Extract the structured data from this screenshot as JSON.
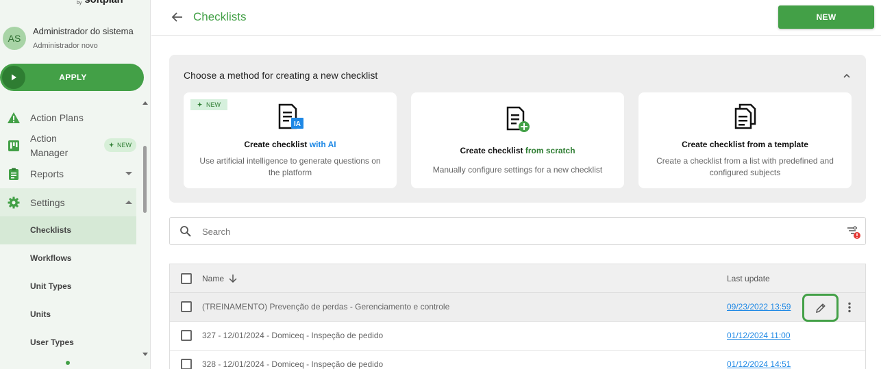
{
  "brand": {
    "by": "by",
    "name": "softplan"
  },
  "user": {
    "initials": "AS",
    "name": "Administrador do sistema",
    "role": "Administrador novo"
  },
  "apply_label": "APPLY",
  "sidebar": {
    "items": [
      {
        "label": "Action Plans",
        "icon": "warning-icon"
      },
      {
        "label": "Action\nManager",
        "icon": "kanban-icon",
        "badge": "NEW"
      },
      {
        "label": "Reports",
        "icon": "clipboard-icon"
      },
      {
        "label": "Settings",
        "icon": "gear-icon"
      }
    ],
    "settings_sub": [
      "Checklists",
      "Workflows",
      "Unit Types",
      "Units",
      "User Types"
    ],
    "active_sub": "Checklists"
  },
  "header": {
    "title": "Checklists",
    "new_button": "NEW"
  },
  "methods": {
    "title": "Choose a method for creating a new checklist",
    "cards": [
      {
        "badge": "NEW",
        "title_prefix": "Create checklist ",
        "title_highlight": "with AI",
        "description": "Use artificial intelligence to generate questions on the platform"
      },
      {
        "title_prefix": "Create checklist ",
        "title_highlight": "from scratch",
        "description": "Manually configure settings for a new checklist"
      },
      {
        "title_prefix": "Create checklist from a template",
        "title_highlight": "",
        "description": "Create a checklist from a list with predefined and configured subjects"
      }
    ]
  },
  "search": {
    "placeholder": "Search",
    "value": ""
  },
  "table": {
    "columns": {
      "name": "Name",
      "last_update": "Last update"
    },
    "rows": [
      {
        "name": "(TREINAMENTO) Prevenção de perdas - Gerenciamento e controle",
        "last_update": "09/23/2022 13:59"
      },
      {
        "name": "327 - 12/01/2024 - Domiceq - Inspeção de pedido",
        "last_update": "01/12/2024 11:00"
      },
      {
        "name": "328 - 12/01/2024 - Domiceq - Inspeção de pedido",
        "last_update": "01/12/2024 14:51"
      }
    ]
  },
  "colors": {
    "primary": "#43a047",
    "link": "#1e88e5",
    "sidebar_bg": "#f1f6f1"
  }
}
